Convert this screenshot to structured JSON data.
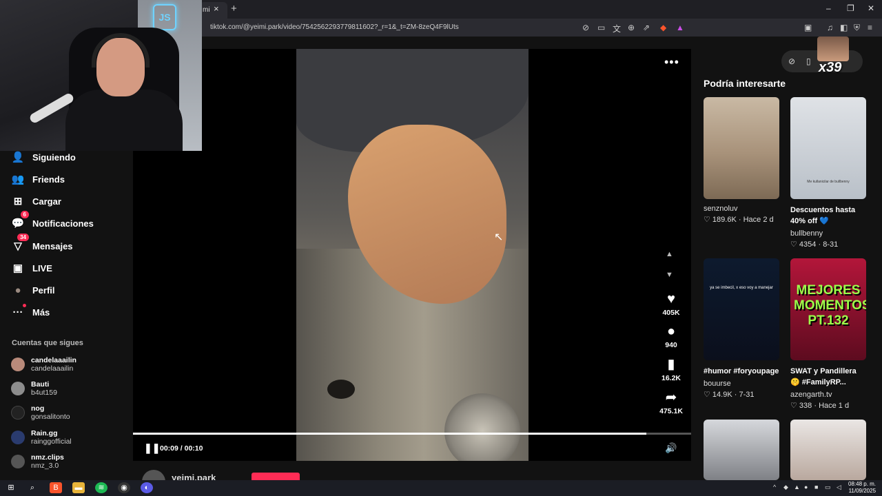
{
  "browser": {
    "tab_title": "mi",
    "tab_close": "×",
    "new_tab": "+",
    "url": "tiktok.com/@yeimi.park/video/7542562293779811602?_r=1&_t=ZM-8zeQ4F9lUts",
    "window_controls": [
      "–",
      "❐",
      "✕"
    ]
  },
  "sidebar": {
    "items": [
      {
        "label": "Siguiendo",
        "icon": "user-follow-icon",
        "glyph": "👤"
      },
      {
        "label": "Friends",
        "icon": "friends-icon",
        "glyph": "👥"
      },
      {
        "label": "Cargar",
        "icon": "upload-icon",
        "glyph": "⊞"
      },
      {
        "label": "Notificaciones",
        "icon": "inbox-icon",
        "glyph": "💬",
        "badge": "6"
      },
      {
        "label": "Mensajes",
        "icon": "send-icon",
        "glyph": "▽",
        "badge": "34"
      },
      {
        "label": "LIVE",
        "icon": "live-icon",
        "glyph": "▣"
      },
      {
        "label": "Perfil",
        "icon": "avatar-icon",
        "glyph": "●"
      },
      {
        "label": "Más",
        "icon": "more-icon",
        "glyph": "···",
        "dot": true
      }
    ],
    "following_heading": "Cuentas que sigues",
    "accounts": [
      {
        "name": "candelaaailin",
        "handle": "candelaaailin",
        "color": "#b98a7a"
      },
      {
        "name": "Bauti",
        "handle": "b4ut159",
        "color": "#8d8d8d"
      },
      {
        "name": "nog",
        "handle": "gonsalitonto",
        "color": "#222"
      },
      {
        "name": "Rain.gg",
        "handle": "rainggofficial",
        "color": "#2a3b6e"
      },
      {
        "name": "nmz.clips",
        "handle": "nmz_3.0",
        "color": "#555"
      }
    ]
  },
  "video": {
    "more": "•••",
    "likes": "405K",
    "comments": "940",
    "saves": "16.2K",
    "shares": "475.1K",
    "time": "00:09 / 00:10",
    "progress": 0.92,
    "author": "yeimi.park",
    "pause_glyph": "❚❚",
    "volume_glyph": "🔊"
  },
  "right": {
    "gift_count": "x39",
    "heading": "Podría interesarte",
    "cards": [
      {
        "title": "",
        "user": "senznoluv",
        "likes": "189.6K",
        "date": "Hace 2 d",
        "bg": "linear-gradient(180deg,#c9b9a4 0%,#a8927a 55%,#7d6a55 100%)"
      },
      {
        "title": "Descuentos hasta 40% off 💙",
        "user": "bullbenny",
        "likes": "4354",
        "date": "8-31",
        "bg": "linear-gradient(180deg,#dfe2e6 0%,#b9c0c8 100%)",
        "caption": "Me kullanicilar de bullbenny"
      },
      {
        "title": "#humor #foryoupage",
        "user": "bouurse",
        "likes": "14.9K",
        "date": "7-31",
        "bg": "linear-gradient(180deg,#0d1a2e 0%,#0b0f1c 100%)",
        "caption": "ya se imbecil, x eso voy a manejar"
      },
      {
        "title": "SWAT y Pandillera 🤫 #FamilyRP...",
        "user": "azengarth.tv",
        "likes": "338",
        "date": "Hace 1 d",
        "bg": "linear-gradient(180deg,#b3163a 0%,#5d0b1f 100%)",
        "caption": "MEJORES MOMENTOS PT.132"
      },
      {
        "title": "",
        "user": "",
        "likes": "",
        "date": "",
        "bg": "linear-gradient(180deg,#d6d8dc 0%,#7f8186 100%)"
      },
      {
        "title": "",
        "user": "",
        "likes": "",
        "date": "",
        "bg": "linear-gradient(180deg,#eae6e4 0%,#b9a89e 100%)"
      }
    ]
  },
  "taskbar": {
    "time": "08:48 p. m.",
    "date": "11/09/2025"
  }
}
